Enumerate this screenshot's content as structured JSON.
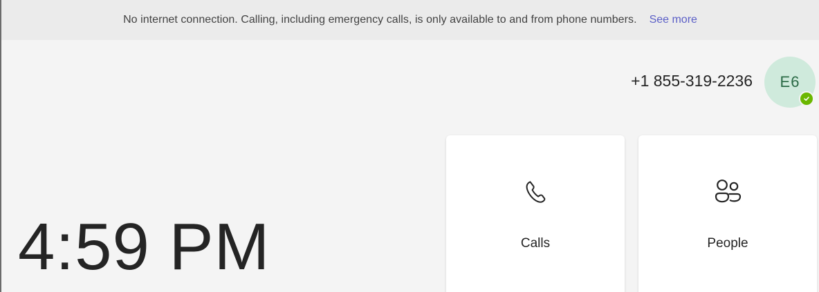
{
  "banner": {
    "message": "No internet connection. Calling, including emergency calls, is only available to and from phone numbers.",
    "link_label": "See more"
  },
  "header": {
    "phone_number": "+1 855-319-2236",
    "avatar_initials": "E6",
    "presence_status": "available",
    "presence_color": "#6bb700"
  },
  "clock": {
    "time": "4:59 PM"
  },
  "tiles": [
    {
      "label": "Calls",
      "icon": "phone-icon"
    },
    {
      "label": "People",
      "icon": "people-icon"
    }
  ],
  "colors": {
    "accent": "#5b5fc7",
    "avatar_bg": "#cfeadc",
    "avatar_text": "#2a6a45"
  }
}
